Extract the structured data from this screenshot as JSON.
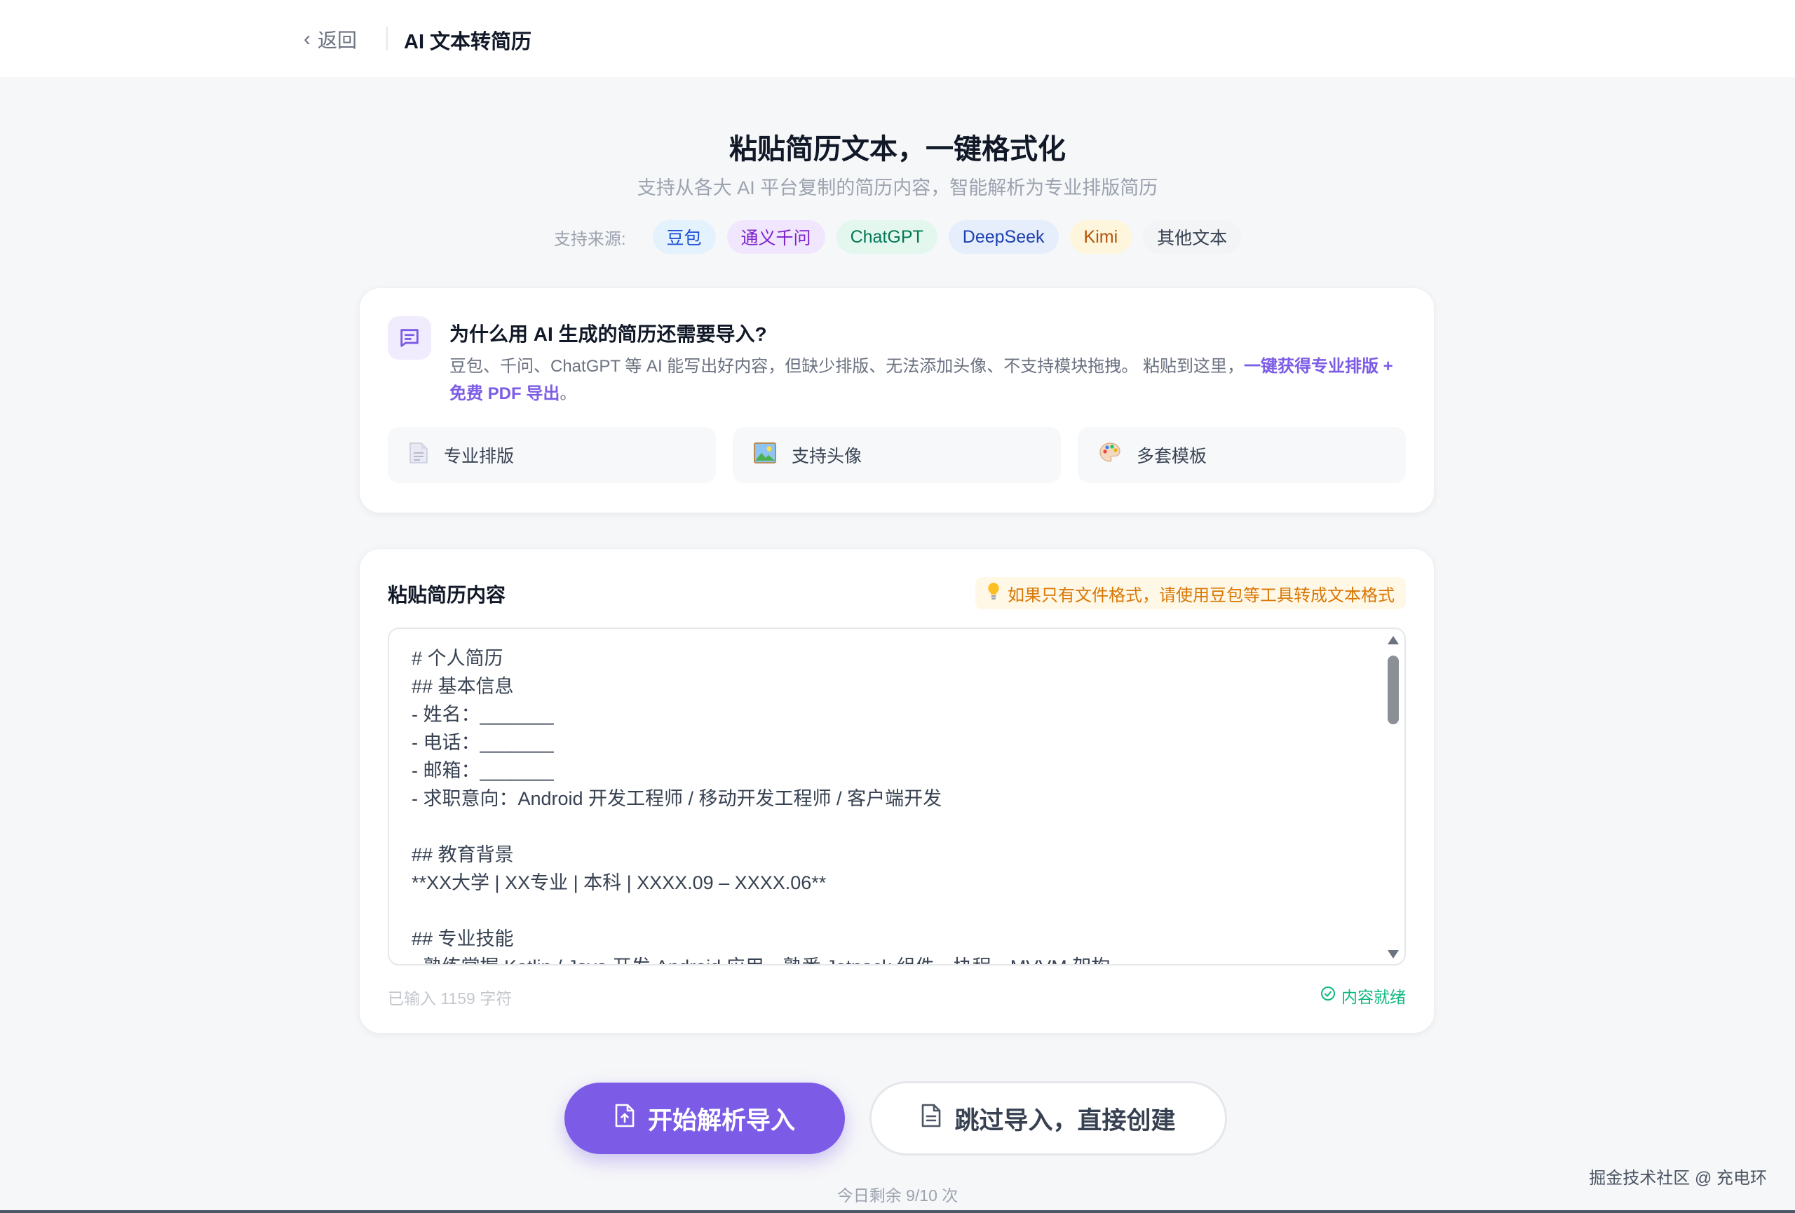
{
  "header": {
    "back_label": "返回",
    "title": "AI 文本转简历"
  },
  "hero": {
    "title": "粘贴简历文本，一键格式化",
    "subtitle": "支持从各大 AI 平台复制的简历内容，智能解析为专业排版简历",
    "sources_label": "支持来源:",
    "sources": [
      {
        "label": "豆包",
        "bg": "#e3f2fd",
        "color": "#1d4ed8"
      },
      {
        "label": "通义千问",
        "bg": "#f0e6fd",
        "color": "#7e22ce"
      },
      {
        "label": "ChatGPT",
        "bg": "#e3f7ee",
        "color": "#047857"
      },
      {
        "label": "DeepSeek",
        "bg": "#e6eefc",
        "color": "#1e40af"
      },
      {
        "label": "Kimi",
        "bg": "#fef6dc",
        "color": "#b45309"
      },
      {
        "label": "其他文本",
        "bg": "#f3f4f6",
        "color": "#374151"
      }
    ]
  },
  "why": {
    "icon": "message-lines-icon",
    "title": "为什么用 AI 生成的简历还需要导入?",
    "desc_prefix": "豆包、千问、ChatGPT 等 AI 能写出好内容，但缺少排版、无法添加头像、不支持模块拖拽。 粘贴到这里，",
    "desc_highlight": "一键获得专业排版 + 免费 PDF 导出",
    "desc_suffix": "。",
    "features": [
      {
        "icon": "document-icon",
        "label": "专业排版"
      },
      {
        "icon": "picture-icon",
        "label": "支持头像"
      },
      {
        "icon": "palette-icon",
        "label": "多套模板"
      }
    ]
  },
  "paste": {
    "title": "粘贴简历内容",
    "tip": "如果只有文件格式，请使用豆包等工具转成文本格式",
    "content": "# 个人简历\n## 基本信息\n- 姓名：_______\n- 电话：_______\n- 邮箱：_______\n- 求职意向：Android 开发工程师 / 移动开发工程师 / 客户端开发\n\n## 教育背景\n**XX大学 | XX专业 | 本科 | XXXX.09 – XXXX.06**\n\n## 专业技能\n- 熟练掌握 Kotlin / Java 开发 Android 应用，熟悉 Jetpack 组件、协程、MVVM 架构",
    "count_text": "已输入 1159 字符",
    "ready_text": "内容就绪"
  },
  "actions": {
    "primary_label": "开始解析导入",
    "secondary_label": "跳过导入，直接创建",
    "remaining": "今日剩余 9/10 次"
  },
  "watermark": "掘金技术社区 @ 充电环",
  "colors": {
    "accent": "#7c5ce6",
    "success": "#10b981",
    "warning": "#d97706"
  }
}
